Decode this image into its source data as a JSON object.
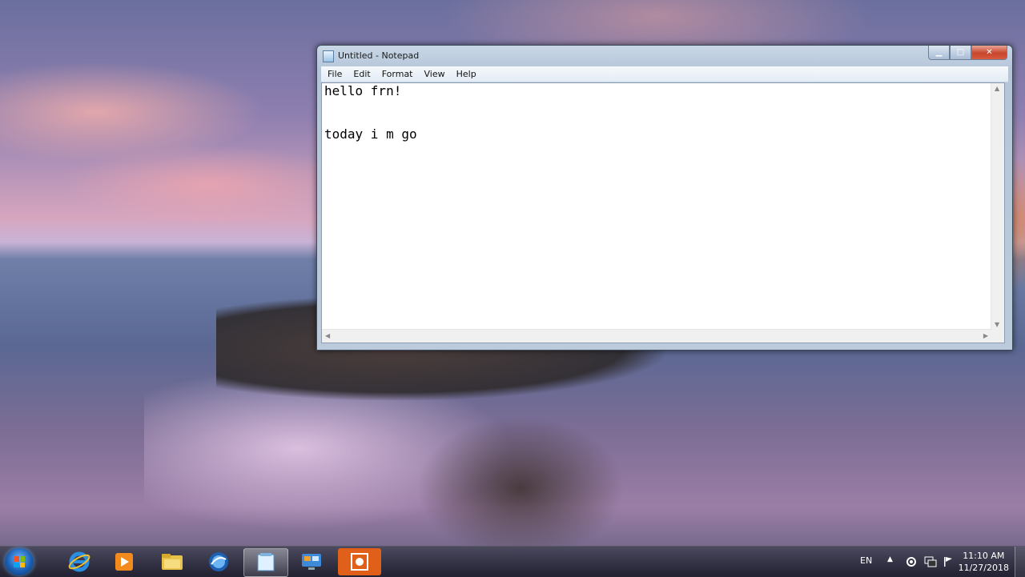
{
  "window": {
    "title": "Untitled - Notepad",
    "controls": {
      "minimize": "▁",
      "maximize": "□",
      "close": "✕"
    }
  },
  "menu": [
    "File",
    "Edit",
    "Format",
    "View",
    "Help"
  ],
  "editor": {
    "lines": [
      "hello frn!",
      "",
      "today i m go"
    ]
  },
  "taskbar": {
    "apps": [
      "internet-explorer",
      "media-player",
      "file-explorer",
      "browser",
      "notepad",
      "remote-desktop",
      "screen-recorder"
    ],
    "active_app": "notepad"
  },
  "tray": {
    "language": "EN",
    "time": "11:10 AM",
    "date": "11/27/2018"
  }
}
